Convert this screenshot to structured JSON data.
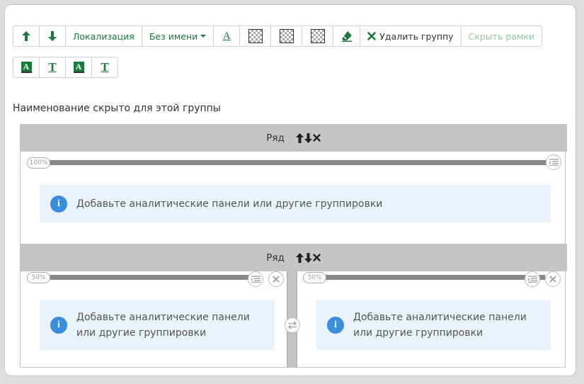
{
  "toolbar": {
    "localization_label": "Локализация",
    "name_select_label": "Без имени",
    "delete_group_label": "Удалить группу",
    "hide_borders_label": "Скрыть рамки"
  },
  "group": {
    "title": "Наименование скрыто для этой группы"
  },
  "rows": [
    {
      "label": "Ряд",
      "columns": [
        {
          "width_label": "100%",
          "message": "Добавьте аналитические панели или другие группировки"
        }
      ]
    },
    {
      "label": "Ряд",
      "columns": [
        {
          "width_label": "50%",
          "message_line1": "Добавьте аналитические панели",
          "message_line2": "или другие группировки"
        },
        {
          "width_label": "50%",
          "message_line1": "Добавьте аналитические панели",
          "message_line2": "или другие группировки"
        }
      ]
    }
  ],
  "colors": {
    "accent": "#1a7a3c",
    "info": "#3a8ee0",
    "row_header": "#c5c5c5"
  }
}
